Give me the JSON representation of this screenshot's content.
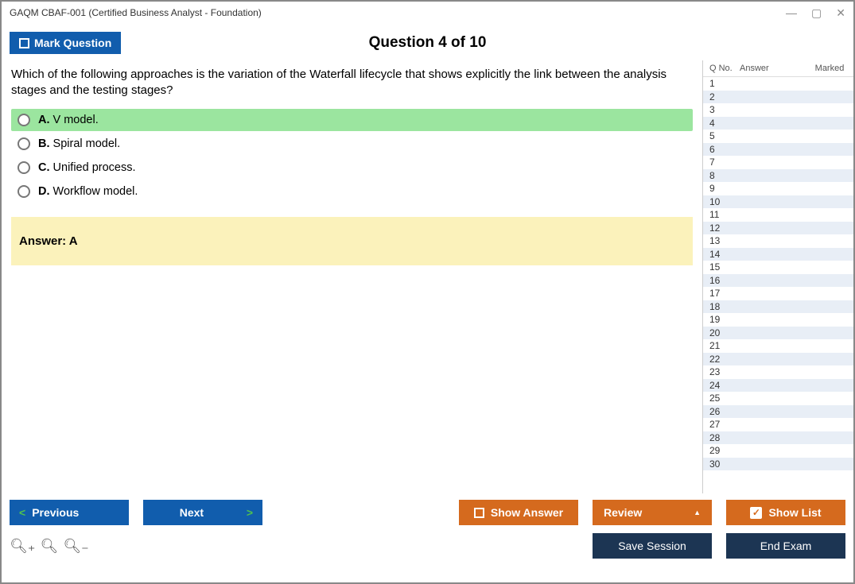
{
  "window": {
    "title": "GAQM CBAF-001 (Certified Business Analyst - Foundation)"
  },
  "header": {
    "mark_label": "Mark Question",
    "question_title": "Question 4 of 10"
  },
  "question": {
    "text": "Which of the following approaches is the variation of the Waterfall lifecycle that shows explicitly the link between the analysis stages and the testing stages?",
    "options": {
      "a": {
        "letter": "A.",
        "text": " V model."
      },
      "b": {
        "letter": "B.",
        "text": " Spiral model."
      },
      "c": {
        "letter": "C.",
        "text": " Unified process."
      },
      "d": {
        "letter": "D.",
        "text": " Workflow model."
      }
    },
    "answer_label": "Answer: A"
  },
  "sidebar": {
    "headers": {
      "qno": "Q No.",
      "answer": "Answer",
      "marked": "Marked"
    },
    "row_count": 30
  },
  "buttons": {
    "previous": "Previous",
    "next": "Next",
    "show_answer": "Show Answer",
    "review": "Review",
    "show_list": "Show List",
    "save_session": "Save Session",
    "end_exam": "End Exam"
  }
}
